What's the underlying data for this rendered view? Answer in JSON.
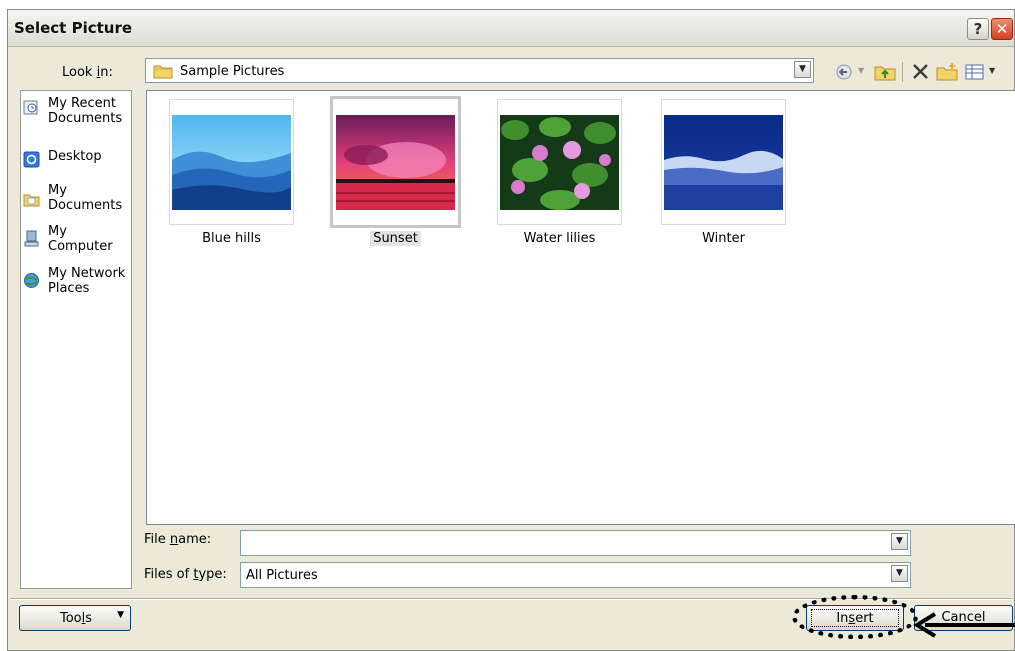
{
  "window": {
    "title": "Select Picture",
    "help_glyph": "?",
    "close_glyph": "✕"
  },
  "lookin": {
    "label_pre": "Look ",
    "label_key": "i",
    "label_post": "n:",
    "value": "Sample Pictures"
  },
  "toolbar": {
    "icons": [
      "back-icon",
      "up-folder-icon",
      "delete-icon",
      "new-folder-icon",
      "views-icon"
    ]
  },
  "places": [
    {
      "label": "My Recent Documents",
      "icon": "recent-documents-icon"
    },
    {
      "label": "Desktop",
      "icon": "desktop-icon"
    },
    {
      "label": "My Documents",
      "icon": "my-documents-icon"
    },
    {
      "label": "My Computer",
      "icon": "my-computer-icon"
    },
    {
      "label": "My Network Places",
      "icon": "network-places-icon"
    }
  ],
  "files": [
    {
      "name": "Blue hills",
      "selected": false
    },
    {
      "name": "Sunset",
      "selected": true
    },
    {
      "name": "Water lilies",
      "selected": false
    },
    {
      "name": "Winter",
      "selected": false
    }
  ],
  "filename": {
    "label_pre": "File ",
    "label_key": "n",
    "label_post": "ame:",
    "value": ""
  },
  "filetype": {
    "label_pre": "Files of ",
    "label_key": "t",
    "label_post": "ype:",
    "value": "All Pictures"
  },
  "buttons": {
    "tools": {
      "pre": "Too",
      "key": "l",
      "post": "s"
    },
    "insert": {
      "pre": "In",
      "key": "s",
      "post": "ert"
    },
    "cancel": "Cancel"
  },
  "colors": {
    "dialog_bg": "#ece9d8",
    "close_red": "#d4411f",
    "button_border": "#003c74",
    "annotation": "#000000"
  }
}
